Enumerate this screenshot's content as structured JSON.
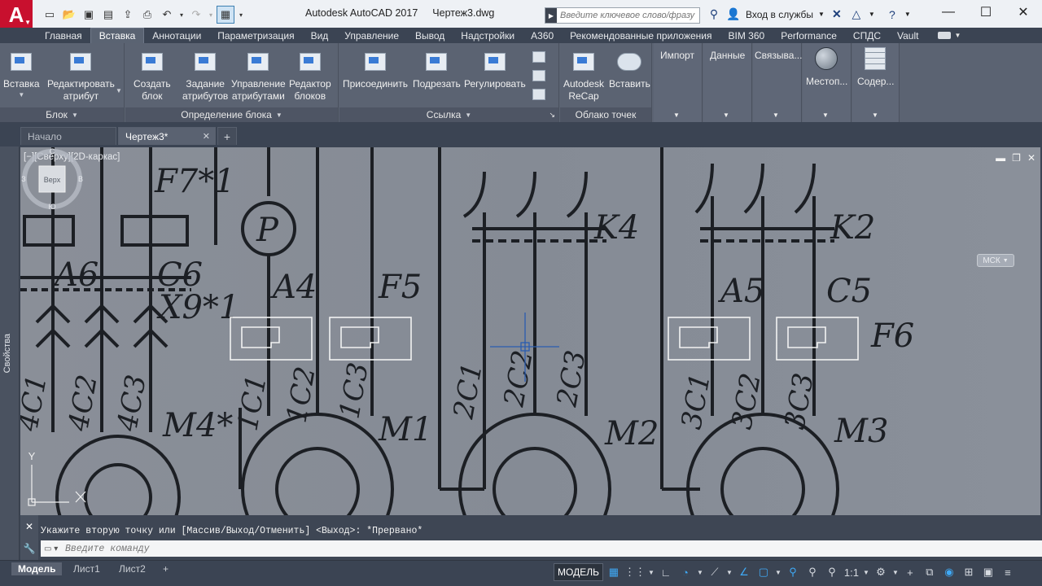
{
  "app": {
    "title": "Autodesk AutoCAD 2017",
    "document": "Чертеж3.dwg",
    "logo": "A",
    "accent_color": "#c8102e"
  },
  "search": {
    "placeholder": "Введите ключевое слово/фразу",
    "signin_label": "Вход в службы"
  },
  "ribbon_tabs": [
    "Главная",
    "Вставка",
    "Аннотации",
    "Параметризация",
    "Вид",
    "Управление",
    "Вывод",
    "Надстройки",
    "A360",
    "Рекомендованные приложения",
    "BIM 360",
    "Performance",
    "СПДС",
    "Vault"
  ],
  "active_ribbon_tab": "Вставка",
  "ribbon": {
    "block_panel": {
      "title": "Блок",
      "insert": "Вставка",
      "edit_attr_1": "Редактировать",
      "edit_attr_2": "атрибут"
    },
    "block_def_panel": {
      "title": "Определение блока",
      "create_1": "Создать",
      "create_2": "блок",
      "attr_def_1": "Задание",
      "attr_def_2": "атрибутов",
      "manage_attr_1": "Управление",
      "manage_attr_2": "атрибутами",
      "block_editor_1": "Редактор",
      "block_editor_2": "блоков"
    },
    "reference_panel": {
      "title": "Ссылка",
      "attach": "Присоединить",
      "clip": "Подрезать",
      "adjust": "Регулировать"
    },
    "point_cloud_panel": {
      "title": "Облако точек",
      "recap_1": "Autodesk",
      "recap_2": "ReCap",
      "insert": "Вставить"
    },
    "import_panel": {
      "title": "Импорт"
    },
    "data_panel": {
      "title": "Данные"
    },
    "link_panel": {
      "title": "Связыва..."
    },
    "location_panel": {
      "title": "Местоп..."
    },
    "content_panel": {
      "title": "Содер..."
    }
  },
  "doc_tabs": {
    "start": "Начало",
    "active": "Чертеж3*"
  },
  "viewport": {
    "label": "[−][Сверху][2D-каркас]",
    "viewcube": {
      "top": "Верх",
      "north": "С",
      "south": "Ю",
      "west": "З",
      "east": "В"
    },
    "ucs": "МСК",
    "ucs_y": "Y",
    "ucs_x": "X"
  },
  "drawing_labels": {
    "f7": "F7*1",
    "a6": "A6",
    "c6": "C6",
    "x9": "X9*1",
    "a4": "A4",
    "p": "P",
    "f5": "F5",
    "k4": "K4",
    "k2": "K2",
    "a5": "A5",
    "c5": "C5",
    "f6": "F6",
    "m4": "M4*",
    "m1": "M1",
    "m2": "M2",
    "m3": "M3",
    "c4c1": "4C1",
    "c4c2": "4C2",
    "c4c3": "4C3",
    "c1c1": "1C1",
    "c1c2": "1C2",
    "c1c3": "1C3",
    "c2c1": "2C1",
    "c2c2": "2C2",
    "c2c3": "2C3",
    "c3c1": "3C1",
    "c3c2": "3C2",
    "c3c3": "3C3"
  },
  "properties_palette": "Свойства",
  "command": {
    "history": "Укажите вторую точку или [Массив/Выход/Отменить] <Выход>: *Прервано*",
    "placeholder": "Введите команду"
  },
  "layout_tabs": [
    "Модель",
    "Лист1",
    "Лист2"
  ],
  "status": {
    "model": "МОДЕЛЬ",
    "scale": "1:1"
  }
}
